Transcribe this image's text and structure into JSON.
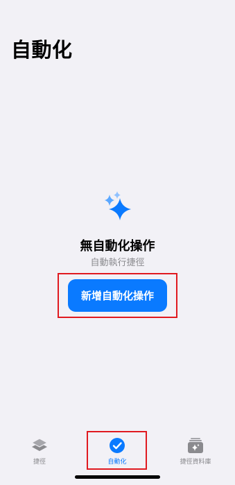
{
  "header": {
    "title": "自動化"
  },
  "empty_state": {
    "icon": "sparkles-icon",
    "title": "無自動化操作",
    "subtitle": "自動執行捷徑",
    "add_button_label": "新增自動化操作"
  },
  "tab_bar": {
    "tabs": [
      {
        "label": "捷徑",
        "icon": "stacked-layers-icon",
        "selected": false
      },
      {
        "label": "自動化",
        "icon": "clock-check-icon",
        "selected": true
      },
      {
        "label": "捷徑資料庫",
        "icon": "gallery-sparkle-icon",
        "selected": false
      }
    ]
  },
  "colors": {
    "background": "#f2f1f6",
    "accent": "#0a7aff",
    "secondary_text": "#8a8a8e",
    "highlight": "#e0191f"
  }
}
